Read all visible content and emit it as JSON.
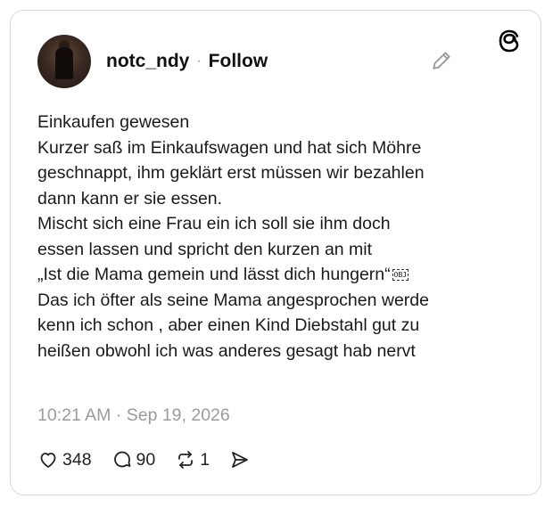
{
  "post": {
    "username": "notc_ndy",
    "separator": "·",
    "follow_label": "Follow",
    "lines": [
      "Einkaufen gewesen",
      "Kurzer saß im Einkaufswagen und hat sich Möhre",
      "geschnappt, ihm geklärt erst müssen wir bezahlen",
      "dann kann er sie essen.",
      "Mischt sich eine Frau ein ich soll sie ihm doch",
      "essen lassen und spricht den kurzen an mit",
      "„Ist die Mama gemein und lässt dich hungern“",
      "Das ich öfter als seine Mama angesprochen werde",
      "kenn ich schon , aber einen Kind Diebstahl gut zu",
      "heißen obwohl ich was anderes  gesagt hab nervt"
    ],
    "obj_glyph": "OBJ",
    "timestamp": "10:21 AM · Sep 19, 2026"
  },
  "actions": {
    "likes": "348",
    "replies": "90",
    "reposts": "1"
  },
  "icons": {
    "like": "heart-icon",
    "reply": "comment-icon",
    "repost": "repost-icon",
    "share": "send-icon",
    "edit": "pencil-icon",
    "brand": "threads-logo-icon"
  }
}
